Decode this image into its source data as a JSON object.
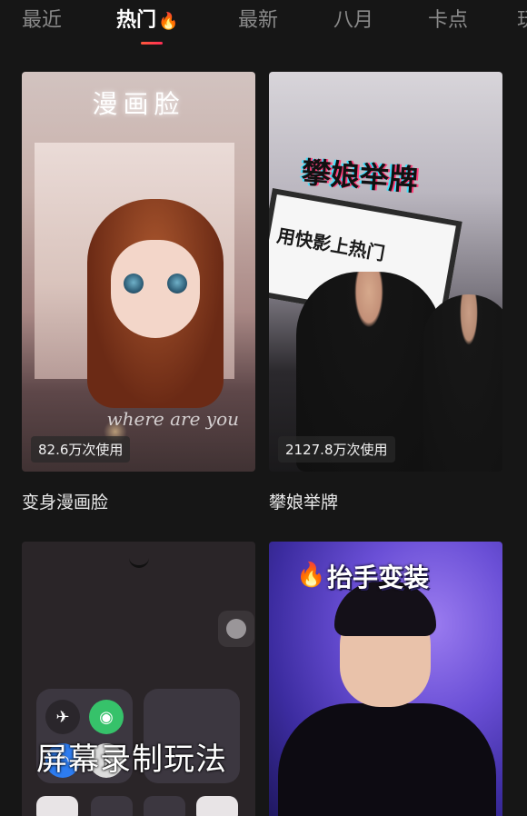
{
  "tabs": [
    {
      "label": "最近",
      "active": false
    },
    {
      "label": "热门",
      "active": true,
      "icon": "fire-icon"
    },
    {
      "label": "最新",
      "active": false
    },
    {
      "label": "八月",
      "active": false
    },
    {
      "label": "卡点",
      "active": false
    },
    {
      "label": "玩",
      "active": false
    }
  ],
  "colors": {
    "background": "#161616",
    "indicator": "#ff3f47"
  },
  "cards": [
    {
      "title": "变身漫画脸",
      "usage": "82.6万次使用",
      "overlay_text": "漫画脸",
      "script_text": "where are you"
    },
    {
      "title": "攀娘举牌",
      "usage": "2127.8万次使用",
      "overlay_text": "攀娘举牌",
      "board_text": "用快影上热门"
    },
    {
      "overlay_text": "屏幕录制玩法"
    },
    {
      "overlay_text": "抬手变装",
      "icon": "fire-icon"
    }
  ]
}
